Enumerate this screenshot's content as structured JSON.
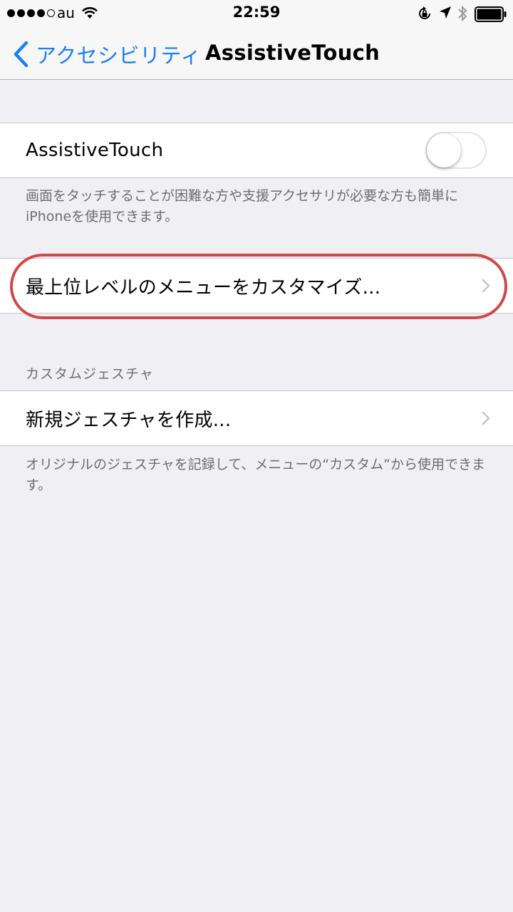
{
  "status_bar": {
    "carrier": "au",
    "time": "22:59"
  },
  "nav": {
    "back_label": "アクセシビリティ",
    "title": "AssistiveTouch"
  },
  "assistive_touch": {
    "label": "AssistiveTouch",
    "enabled": false,
    "footer": "画面をタッチすることが困難な方や支援アクセサリが必要な方も簡単にiPhoneを使用できます。"
  },
  "menu": {
    "customize_label": "最上位レベルのメニューをカスタマイズ..."
  },
  "custom_gestures": {
    "header": "カスタムジェスチャ",
    "create_label": "新規ジェスチャを作成...",
    "footer": "オリジナルのジェスチャを記録して、メニューの“カスタム”から使用できます。"
  },
  "colors": {
    "accent": "#1a7ff5",
    "background": "#efeff4",
    "highlight": "#d04848"
  }
}
